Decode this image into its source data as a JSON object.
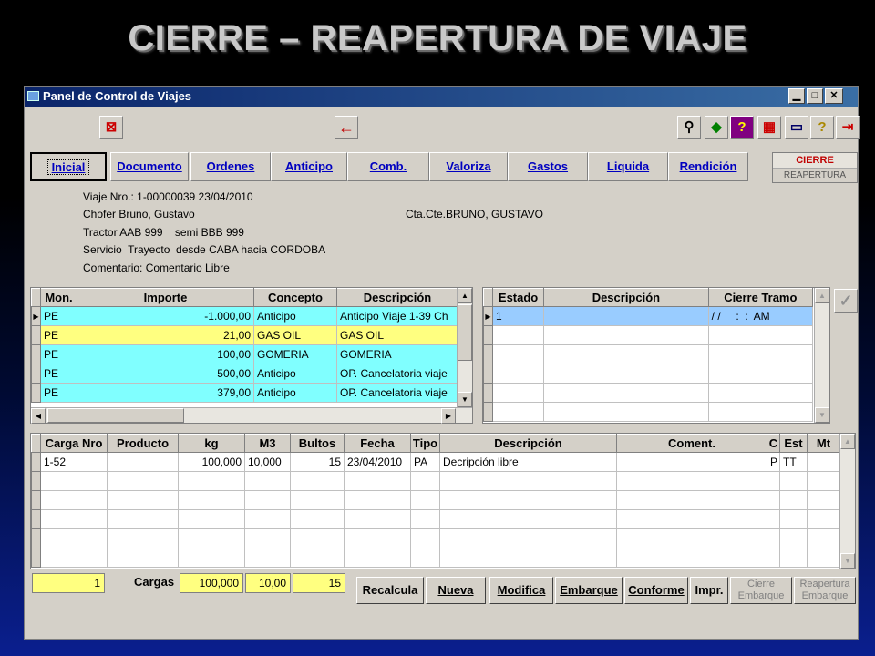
{
  "slide_title": "CIERRE – REAPERTURA DE VIAJE",
  "window": {
    "title": "Panel de Control de Viajes",
    "min": "▁",
    "max": "□",
    "close": "✕"
  },
  "toolbar": {
    "print_icon": "⊠",
    "back_icon": "←",
    "search_icon": "⚲",
    "bookmark_icon": "◆",
    "help_icon": "?",
    "calc_icon": "▦",
    "screen_icon": "▭",
    "info_icon": "?",
    "exit_icon": "⇥"
  },
  "tabs": [
    "Inicial",
    "Documento",
    "Ordenes",
    "Anticipo",
    "Comb.",
    "Valoriza",
    "Gastos",
    "Liquida",
    "Rendición"
  ],
  "cierre": {
    "top": "CIERRE",
    "bottom": "REAPERTURA"
  },
  "info": {
    "viaje": "Viaje Nro.: 1-00000039 23/04/2010",
    "chofer": "Chofer Bruno, Gustavo",
    "ctacte": "Cta.Cte.BRUNO, GUSTAVO",
    "tractor": "Tractor AAB 999    semi BBB 999",
    "servicio": "Servicio  Trayecto  desde CABA hacia CORDOBA",
    "comentario": "Comentario: Comentario Libre"
  },
  "grid1": {
    "headers": [
      "Mon.",
      "Importe",
      "Concepto",
      "Descripción"
    ],
    "rows": [
      {
        "mon": "PE",
        "importe": "-1.000,00",
        "concepto": "Anticipo",
        "desc": "Anticipo Viaje 1-39 Ch"
      },
      {
        "mon": "PE",
        "importe": "21,00",
        "concepto": "GAS OIL",
        "desc": "GAS OIL"
      },
      {
        "mon": "PE",
        "importe": "100,00",
        "concepto": "GOMERIA",
        "desc": "GOMERIA"
      },
      {
        "mon": "PE",
        "importe": "500,00",
        "concepto": "Anticipo",
        "desc": "OP. Cancelatoria viaje"
      },
      {
        "mon": "PE",
        "importe": "379,00",
        "concepto": "Anticipo",
        "desc": "OP. Cancelatoria viaje"
      }
    ]
  },
  "grid2": {
    "headers": [
      "Estado",
      "Descripción",
      "Cierre Tramo"
    ],
    "rows": [
      {
        "estado": "1",
        "desc": "",
        "cierre": "/ /     :  :  AM"
      }
    ]
  },
  "grid3": {
    "headers": [
      "Carga Nro",
      "Producto",
      "kg",
      "M3",
      "Bultos",
      "Fecha",
      "Tipo",
      "Descripción",
      "Coment.",
      "C",
      "Est",
      "Mt"
    ],
    "rows": [
      {
        "carga": "1-52",
        "producto": "",
        "kg": "100,000",
        "m3": "10,000",
        "bultos": "15",
        "fecha": "23/04/2010",
        "tipo": "PA",
        "desc": "Decripción libre",
        "coment": "",
        "c": "P",
        "est": "TT",
        "mt": ""
      }
    ]
  },
  "totals": {
    "count": "1",
    "label": "Cargas",
    "kg": "100,000",
    "m3": "10,00",
    "bultos": "15"
  },
  "buttons": {
    "recalcula": "Recalcula",
    "nueva": "Nueva",
    "modifica": "Modifica",
    "embarque": "Embarque",
    "conforme": "Conforme",
    "impr": "Impr.",
    "cierre_emb_1": "Cierre",
    "cierre_emb_2": "Embarque",
    "reap_emb_1": "Reapertura",
    "reap_emb_2": "Embarque"
  },
  "check_icon": "✓"
}
